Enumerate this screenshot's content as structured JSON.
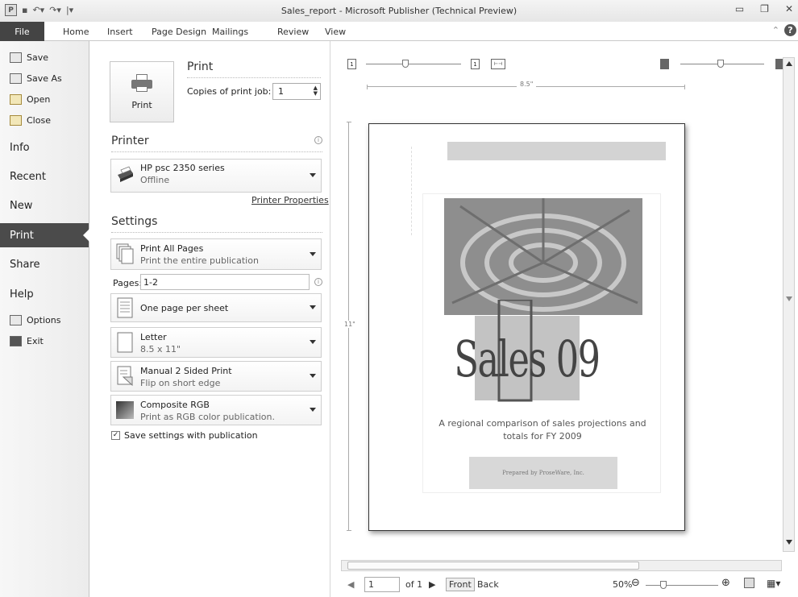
{
  "titlebar": {
    "title": "Sales_report - Microsoft Publisher (Technical Preview)"
  },
  "ribbon": {
    "file": "File",
    "tabs": [
      "Home",
      "Insert",
      "Page Design",
      "Mailings",
      "Review",
      "View"
    ]
  },
  "nav": {
    "commands": [
      "Save",
      "Save As",
      "Open",
      "Close"
    ],
    "tabs": [
      "Info",
      "Recent",
      "New",
      "Print",
      "Share",
      "Help"
    ],
    "bottom_commands": [
      "Options",
      "Exit"
    ],
    "active_tab": "Print"
  },
  "print": {
    "heading": "Print",
    "button_label": "Print",
    "copies_label": "Copies of print job:",
    "copies_value": "1"
  },
  "printer": {
    "heading": "Printer",
    "name": "HP psc 2350 series",
    "status": "Offline",
    "properties_link": "Printer Properties"
  },
  "settings": {
    "heading": "Settings",
    "pages_scope": {
      "title": "Print All Pages",
      "desc": "Print the entire publication"
    },
    "pages_label": "Pages:",
    "pages_value": "1-2",
    "layout": {
      "title": "One page per sheet"
    },
    "paper": {
      "title": "Letter",
      "desc": "8.5 x 11\""
    },
    "sides": {
      "title": "Manual 2 Sided Print",
      "desc": "Flip on short edge"
    },
    "color": {
      "title": "Composite RGB",
      "desc": "Print as RGB color publication."
    },
    "save_checkbox": "Save settings with publication",
    "save_checked": true
  },
  "preview": {
    "ruler_width": "8.5\"",
    "ruler_height": "11\"",
    "page": {
      "title": "Sales 09",
      "body": "A regional comparison of sales projections and totals for FY 2009",
      "prepared": "Prepared by ProseWare, Inc."
    },
    "status": {
      "page_number": "1",
      "of_pages": "of 1",
      "front": "Front",
      "back": "Back",
      "zoom": "50%"
    }
  }
}
